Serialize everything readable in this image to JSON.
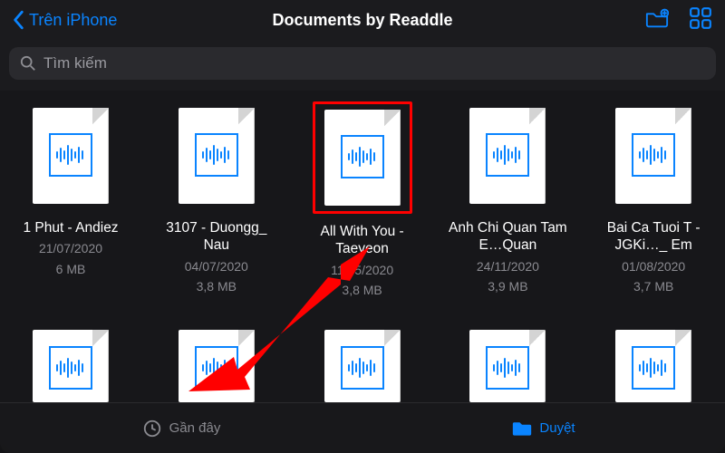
{
  "nav": {
    "back_label": "Trên iPhone",
    "title": "Documents by Readdle"
  },
  "search": {
    "placeholder": "Tìm kiếm"
  },
  "files": [
    {
      "name": "1 Phut - Andiez",
      "date": "21/07/2020",
      "size": "6 MB",
      "highlight": false
    },
    {
      "name": "3107 - Duongg_ Nau",
      "date": "04/07/2020",
      "size": "3,8 MB",
      "highlight": false
    },
    {
      "name": "All With You - Taeyeon",
      "date": "11/05/2020",
      "size": "3,8 MB",
      "highlight": true
    },
    {
      "name": "Anh Chi Quan Tam E…Quan",
      "date": "24/11/2020",
      "size": "3,9 MB",
      "highlight": false
    },
    {
      "name": "Bai Ca Tuoi T - JGKi…_ Em",
      "date": "01/08/2020",
      "size": "3,7 MB",
      "highlight": false
    }
  ],
  "tabs": {
    "recent": "Gần đây",
    "browse": "Duyệt"
  }
}
